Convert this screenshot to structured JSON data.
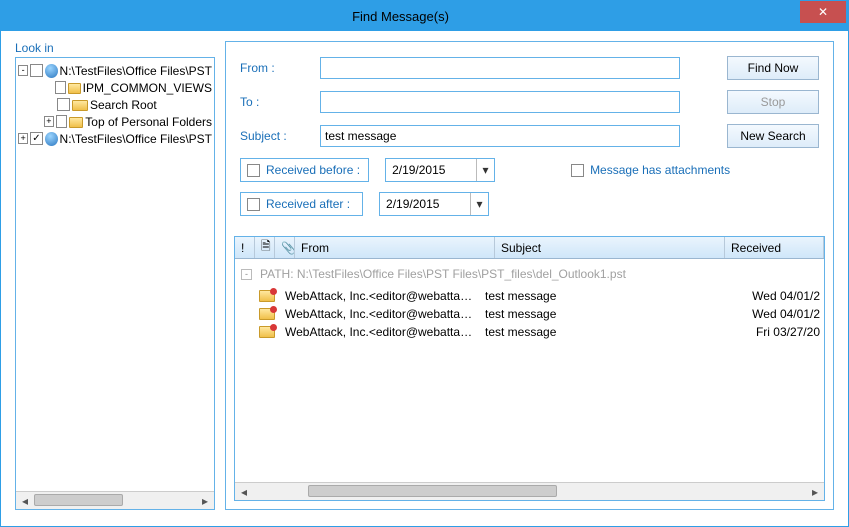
{
  "window": {
    "title": "Find Message(s)"
  },
  "left": {
    "label": "Look in",
    "items": [
      {
        "indent": 0,
        "toggle": "-",
        "checked": false,
        "icon": "pst",
        "label": "N:\\TestFiles\\Office Files\\PST"
      },
      {
        "indent": 1,
        "toggle": "",
        "checked": false,
        "icon": "folder",
        "label": "IPM_COMMON_VIEWS"
      },
      {
        "indent": 1,
        "toggle": "",
        "checked": false,
        "icon": "folder",
        "label": "Search Root"
      },
      {
        "indent": 1,
        "toggle": "+",
        "checked": false,
        "icon": "folder",
        "label": "Top of Personal Folders"
      },
      {
        "indent": 0,
        "toggle": "+",
        "checked": true,
        "icon": "pst",
        "label": "N:\\TestFiles\\Office Files\\PST"
      }
    ]
  },
  "form": {
    "from_label": "From :",
    "from_value": "",
    "to_label": "To :",
    "to_value": "",
    "subject_label": "Subject :",
    "subject_value": "test message",
    "find_now": "Find Now",
    "stop": "Stop",
    "new_search": "New Search",
    "recv_before_label": "Received before :",
    "recv_before_value": "2/19/2015",
    "recv_after_label": "Received after :",
    "recv_after_value": "2/19/2015",
    "has_att_label": "Message has attachments"
  },
  "results": {
    "headers": {
      "importance": "!",
      "type": "",
      "attachment": "",
      "from": "From",
      "subject": "Subject",
      "received": "Received"
    },
    "icons": {
      "type_glyph": "🗎",
      "att_glyph": "📎"
    },
    "path_label": "PATH:  N:\\TestFiles\\Office Files\\PST Files\\PST_files\\del_Outlook1.pst",
    "rows": [
      {
        "from": "WebAttack, Inc.<editor@webattack.c...",
        "subject": "test message",
        "received": "Wed 04/01/2"
      },
      {
        "from": "WebAttack, Inc.<editor@webattack.c...",
        "subject": "test message",
        "received": "Wed 04/01/2"
      },
      {
        "from": "WebAttack, Inc.<editor@webattack.c...",
        "subject": "test message",
        "received": "Fri 03/27/20"
      }
    ]
  }
}
